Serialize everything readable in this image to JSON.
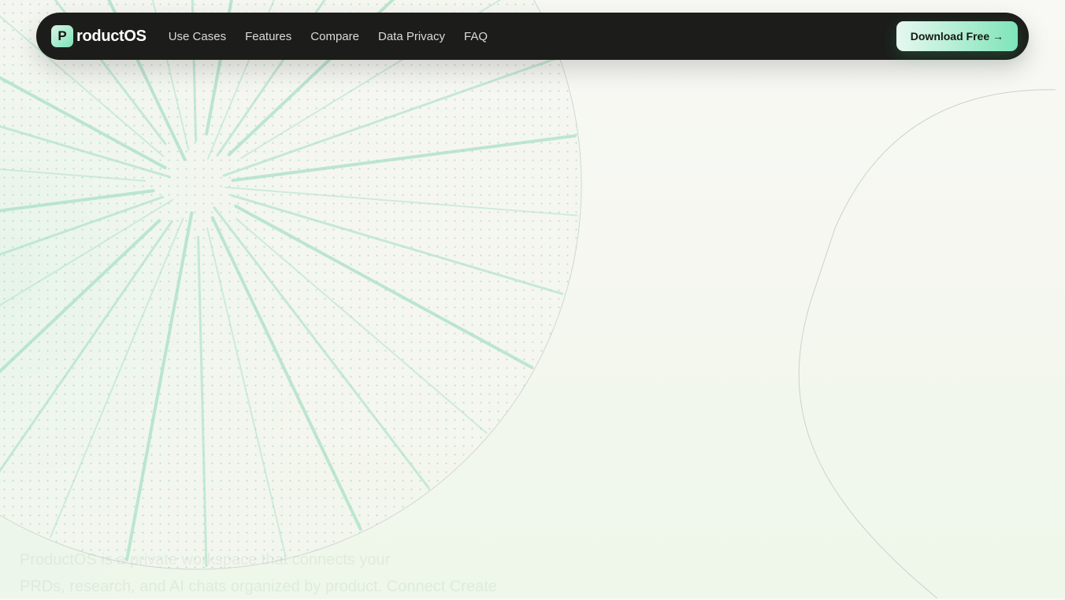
{
  "brand": {
    "mark": "P",
    "name": "roductOS"
  },
  "nav": {
    "links": [
      {
        "label": "Use Cases"
      },
      {
        "label": "Features"
      },
      {
        "label": "Compare"
      },
      {
        "label": "Data Privacy"
      },
      {
        "label": "FAQ"
      }
    ],
    "cta_label": "Download Free →"
  },
  "hero": {
    "faded_lines": [
      "ProductOS is a private workspace that connects your",
      "PRDs, research, and AI chats organized by product. Connect Create"
    ]
  },
  "colors": {
    "nav_background": "#1c1d1a",
    "accent_mint": "#7fe4b9",
    "pattern_green": "#a6dcc0"
  }
}
